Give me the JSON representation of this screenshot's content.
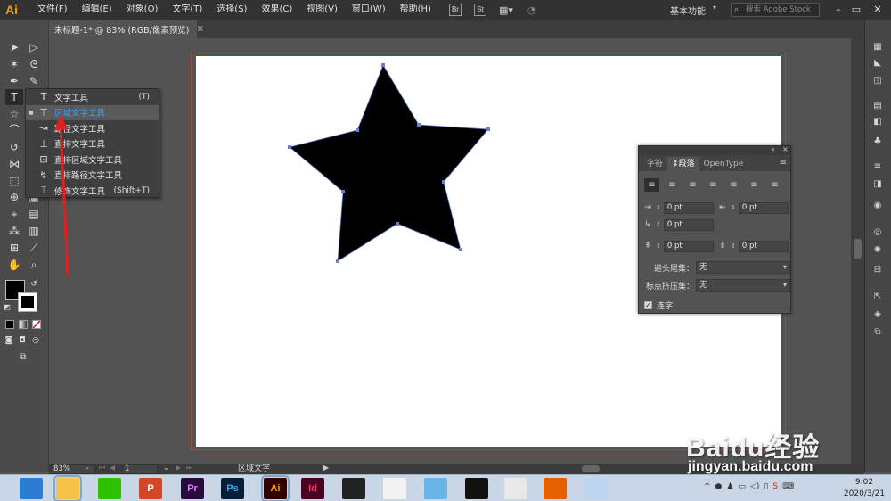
{
  "app": {
    "logo": "Ai"
  },
  "menu": [
    "文件(F)",
    "编辑(E)",
    "对象(O)",
    "文字(T)",
    "选择(S)",
    "效果(C)",
    "视图(V)",
    "窗口(W)",
    "帮助(H)"
  ],
  "menu_chips": [
    "Br",
    "St"
  ],
  "workspace": "基本功能",
  "stock_search_placeholder": "搜索 Adobe Stock",
  "window_controls": [
    "–",
    "▭",
    "✕"
  ],
  "document_tab": {
    "title": "未标题-1* @ 83% (RGB/像素预览)",
    "close": "×"
  },
  "flyout": {
    "items": [
      {
        "label": "文字工具",
        "shortcut": "(T)",
        "icon": "type-tool-icon",
        "selected": false
      },
      {
        "label": "区域文字工具",
        "shortcut": "",
        "icon": "area-type-tool-icon",
        "selected": true
      },
      {
        "label": "路径文字工具",
        "shortcut": "",
        "icon": "type-on-path-tool-icon",
        "selected": false
      },
      {
        "label": "直排文字工具",
        "shortcut": "",
        "icon": "vertical-type-tool-icon",
        "selected": false
      },
      {
        "label": "直排区域文字工具",
        "shortcut": "",
        "icon": "vertical-area-type-tool-icon",
        "selected": false
      },
      {
        "label": "直排路径文字工具",
        "shortcut": "",
        "icon": "vertical-type-on-path-tool-icon",
        "selected": false
      },
      {
        "label": "修饰文字工具",
        "shortcut": "(Shift+T)",
        "icon": "touch-type-tool-icon",
        "selected": false
      }
    ]
  },
  "paragraph_panel": {
    "tabs": [
      "字符",
      "段落",
      "OpenType"
    ],
    "active_tab": "段落",
    "indent_left": "0 pt",
    "indent_right": "0 pt",
    "indent_first": "0 pt",
    "space_before": "0 pt",
    "space_after": "0 pt",
    "kinsoku_label": "避头尾集：",
    "kinsoku_value": "无",
    "mojikumi_label": "标点挤压集：",
    "mojikumi_value": "无",
    "hyphenate_label": "连字",
    "hyphenate_checked": true
  },
  "status": {
    "zoom": "83%",
    "page": "1",
    "tool_name": "区域文字"
  },
  "taskbar": {
    "apps": [
      {
        "name": "edge-icon",
        "label": "",
        "bg": "#2b7cd3",
        "color": "#fff"
      },
      {
        "name": "file-explorer-icon",
        "label": "",
        "bg": "#f3c445",
        "color": "#000",
        "active": true
      },
      {
        "name": "wechat-icon",
        "label": "",
        "bg": "#2dc100",
        "color": "#fff"
      },
      {
        "name": "powerpoint-icon",
        "label": "P",
        "bg": "#d24726",
        "color": "#fff"
      },
      {
        "name": "premiere-icon",
        "label": "Pr",
        "bg": "#2a0a3e",
        "color": "#e77cff"
      },
      {
        "name": "photoshop-icon",
        "label": "Ps",
        "bg": "#061e36",
        "color": "#31a8ff"
      },
      {
        "name": "illustrator-icon",
        "label": "Ai",
        "bg": "#330000",
        "color": "#ff9a00",
        "active": true
      },
      {
        "name": "indesign-icon",
        "label": "Id",
        "bg": "#49021f",
        "color": "#ff3366"
      },
      {
        "name": "video-player-icon",
        "label": "",
        "bg": "#222",
        "color": "#fff"
      },
      {
        "name": "chart-app-icon",
        "label": "",
        "bg": "#f2f2f2",
        "color": "#c00"
      },
      {
        "name": "bird-app-icon",
        "label": "",
        "bg": "#6ab4e6",
        "color": "#fff"
      },
      {
        "name": "qq-icon",
        "label": "",
        "bg": "#111",
        "color": "#fff"
      },
      {
        "name": "chrome-icon",
        "label": "",
        "bg": "#e8e8e8",
        "color": "#333"
      },
      {
        "name": "firefox-icon",
        "label": "",
        "bg": "#e66000",
        "color": "#fff"
      },
      {
        "name": "notes-app-icon",
        "label": "",
        "bg": "#bcd6f0",
        "color": "#333"
      }
    ],
    "time": "9:02",
    "date": "2020/3/21"
  },
  "watermark": {
    "brand": "Baidu经验",
    "url": "jingyan.baidu.com"
  },
  "colors": {
    "accent_selected": "#3aa0ff",
    "artboard_border": "#c23b3b",
    "arrow": "#e02020"
  }
}
